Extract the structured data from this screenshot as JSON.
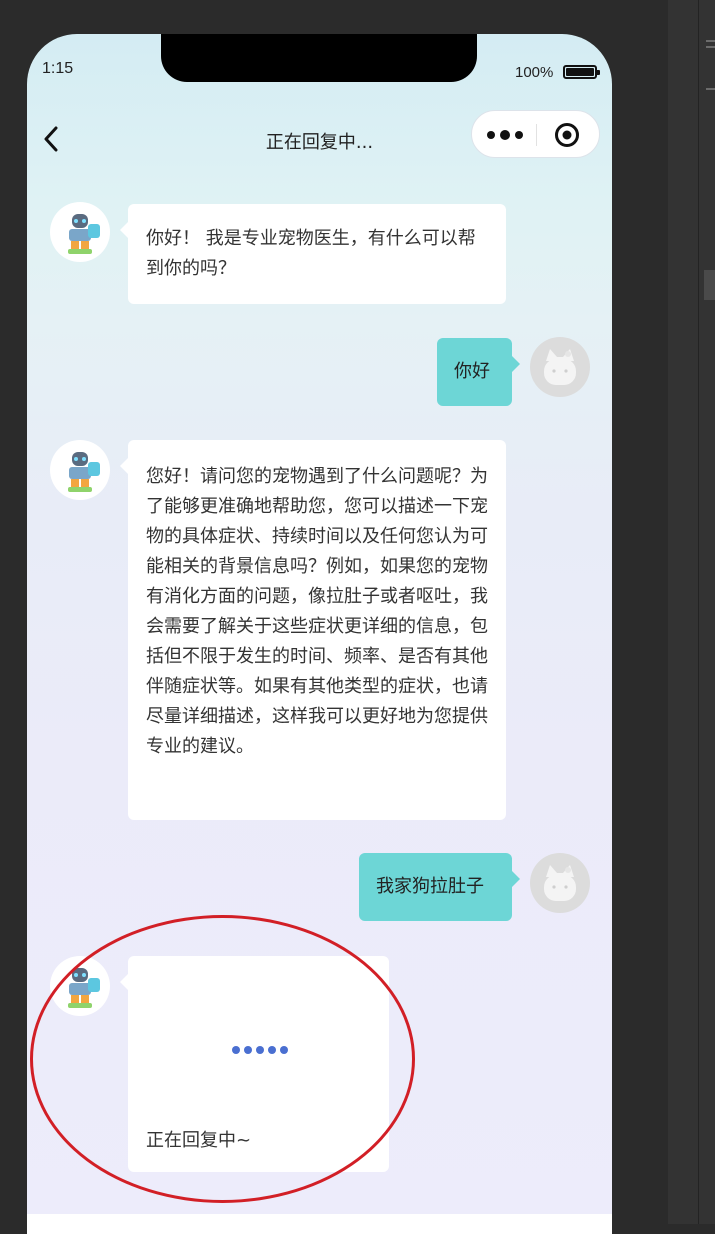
{
  "status_bar": {
    "time": "1:15",
    "battery": "100%"
  },
  "nav": {
    "title": "正在回复中..."
  },
  "messages": [
    {
      "from": "bot",
      "text": "你好！ 我是专业宠物医生，有什么可以帮到你的吗？"
    },
    {
      "from": "user",
      "text": "你好"
    },
    {
      "from": "bot",
      "text": "您好！请问您的宠物遇到了什么问题呢？为了能够更准确地帮助您，您可以描述一下宠物的具体症状、持续时间以及任何您认为可能相关的背景信息吗？例如，如果您的宠物有消化方面的问题，像拉肚子或者呕吐，我会需要了解关于这些症状更详细的信息，包括但不限于发生的时间、频率、是否有其他伴随症状等。如果有其他类型的症状，也请尽量详细描述，这样我可以更好地为您提供专业的建议。"
    },
    {
      "from": "user",
      "text": "我家狗拉肚子"
    },
    {
      "from": "bot",
      "typing": true,
      "text": "正在回复中~"
    }
  ],
  "icons": {
    "back": "chevron-left-icon",
    "more": "more-dots-icon",
    "close": "target-close-icon",
    "bot_avatar": "robot-doctor-avatar",
    "user_avatar": "cat-avatar"
  },
  "colors": {
    "user_bubble": "#6dd6d6",
    "bot_bubble": "#ffffff",
    "typing_dots": "#4a6fd1",
    "annotation": "#d21f26"
  }
}
